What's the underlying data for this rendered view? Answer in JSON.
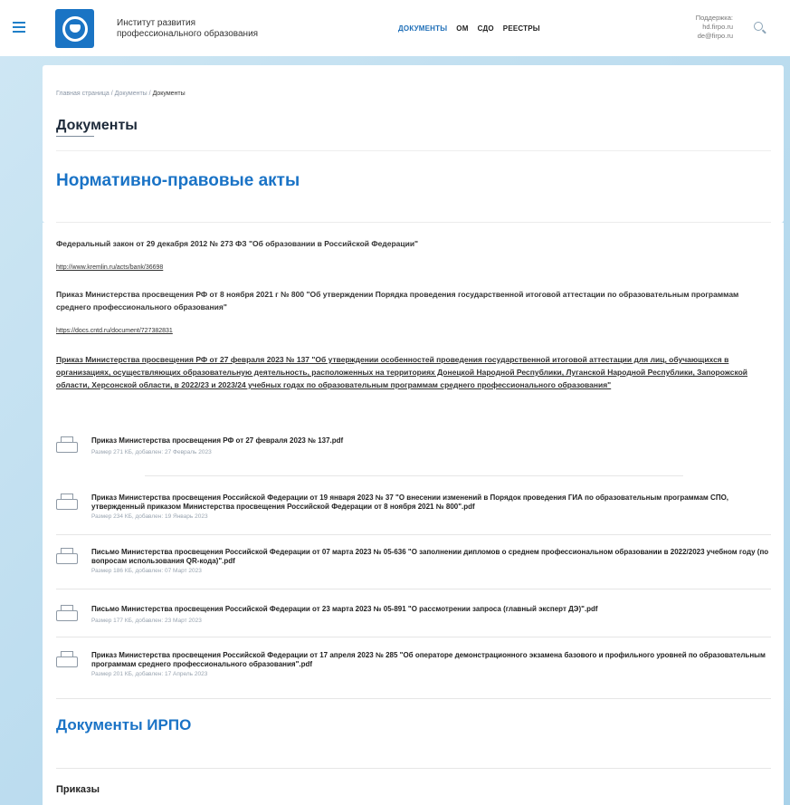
{
  "header": {
    "org_line1": "Институт развития",
    "org_line2": "профессионального образования",
    "nav": [
      "ДОКУМЕНТЫ",
      "ОМ",
      "СДО",
      "РЕЕСТРЫ"
    ],
    "support_label": "Поддержка:",
    "support_email1": "hd.firpo.ru",
    "support_email2": "de@firpo.ru"
  },
  "breadcrumb": {
    "home": "Главная страница",
    "docs": "Документы",
    "current": "Документы",
    "sep": "/"
  },
  "page_title": "Документы",
  "section1_title": "Нормативно-правовые акты",
  "items": {
    "law_title": "Федеральный закон от 29 декабря 2012 № 273 ФЗ \"Об образовании в Российской Федерации\"",
    "law_link": "http://www.kremlin.ru/acts/bank/36698",
    "order800_title": "Приказ Министерства просвещения РФ от 8 ноября 2021 г № 800 \"Об утверждении Порядка проведения государственной итоговой аттестации по образовательным программам среднего профессионального образования\"",
    "order800_link": "https://docs.cntd.ru/document/727382831",
    "order137_title": "Приказ Министерства просвещения РФ от 27 февраля 2023 № 137 \"Об утверждении особенностей проведения государственной итоговой аттестации для лиц, обучающихся в организациях, осуществляющих образовательную деятельность, расположенных на территориях Донецкой Народной Республики, Луганской Народной Республики, Запорожской области, Херсонской области, в 2022/23 и 2023/24 учебных годах по образовательным программам среднего профессионального образования\""
  },
  "files": [
    {
      "title": "Приказ Министерства просвещения РФ от 27 февраля 2023 № 137.pdf",
      "meta": "Размер 271 КБ, добавлен: 27 Февраль 2023"
    },
    {
      "title": "Приказ Министерства просвещения Российской Федерации от 19 января 2023 № 37 \"О внесении изменений в Порядок проведения ГИА по образовательным программам СПО, утвержденный приказом Министерства просвещения Российской Федерации от 8 ноября 2021 № 800\".pdf",
      "meta": "Размер 234 КБ, добавлен: 19 Январь 2023"
    },
    {
      "title": "Письмо Министерства просвещения Российской Федерации от 07 марта 2023 № 05-636 \"О заполнении дипломов о среднем профессиональном образовании в 2022/2023 учебном году (по вопросам использования QR-кода)\".pdf",
      "meta": "Размер 186 КБ, добавлен: 07 Март 2023"
    },
    {
      "title": "Письмо Министерства просвещения Российской Федерации от 23 марта 2023 № 05-891 \"О рассмотрении запроса (главный эксперт ДЭ)\".pdf",
      "meta": "Размер 177 КБ, добавлен: 23 Март 2023"
    },
    {
      "title": "Приказ Министерства просвещения Российской Федерации от 17 апреля 2023 № 285 \"Об операторе демонстрационного экзамена базового и профильного уровней по образовательным программам среднего профессионального образования\".pdf",
      "meta": "Размер 201 КБ, добавлен: 17 Апрель 2023"
    }
  ],
  "section2_title": "Документы ИРПО",
  "subsection_title": "Приказы",
  "colors": {
    "accent": "#1a73c6",
    "logo": "#1a74c4"
  }
}
